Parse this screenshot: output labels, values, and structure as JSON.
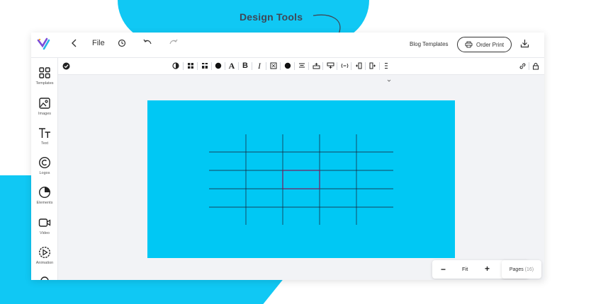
{
  "callout": {
    "label": "Design Tools"
  },
  "topbar": {
    "file_label": "File",
    "blog_templates_label": "Blog Templates",
    "order_print_label": "Order Print"
  },
  "sidebar": {
    "items": [
      {
        "label": "Templates",
        "icon": "templates-icon"
      },
      {
        "label": "Images",
        "icon": "images-icon"
      },
      {
        "label": "Text",
        "icon": "text-icon"
      },
      {
        "label": "Logos",
        "icon": "logos-icon"
      },
      {
        "label": "Elements",
        "icon": "elements-icon"
      },
      {
        "label": "Video",
        "icon": "video-icon"
      },
      {
        "label": "Animation",
        "icon": "animation-icon"
      }
    ]
  },
  "toolbar": {
    "text_tool_label": "A",
    "bold_label": "B",
    "italic_label": "I"
  },
  "footer": {
    "zoom_minus": "−",
    "zoom_label": "Fit",
    "zoom_plus": "+",
    "pages_label": "Pages",
    "pages_count": "(16)"
  },
  "colors": {
    "accent": "#10c8f4",
    "canvas": "#00c8f4",
    "grid_line": "#1a1a2e",
    "selected_cell": "#7a1a5a"
  }
}
